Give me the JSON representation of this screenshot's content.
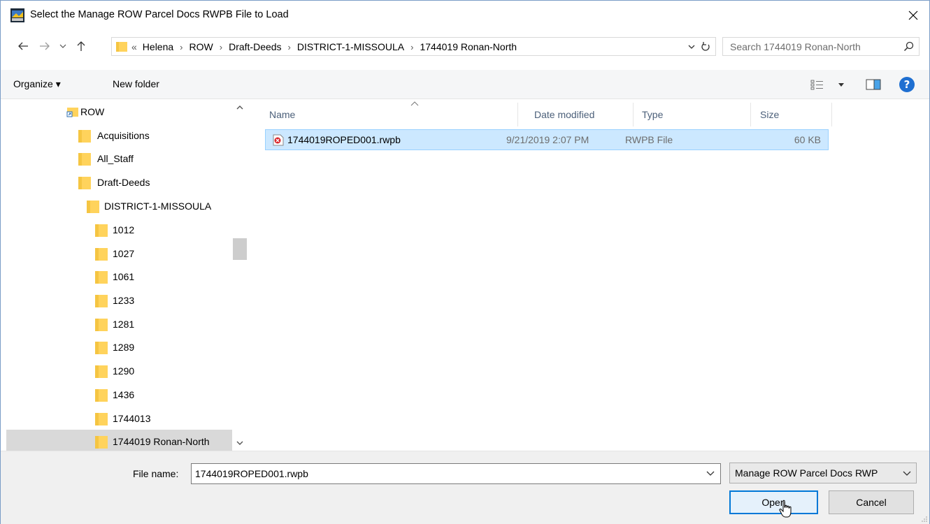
{
  "window": {
    "title": "Select the Manage ROW Parcel Docs RWPB File to Load",
    "close_glyph": "✕"
  },
  "address": {
    "overflow": "«",
    "crumbs": [
      "Helena",
      "ROW",
      "Draft-Deeds",
      "DISTRICT-1-MISSOULA",
      "1744019 Ronan-North"
    ],
    "separator": "›"
  },
  "search": {
    "placeholder": "Search 1744019 Ronan-North"
  },
  "toolbar": {
    "organize_label": "Organize ▾",
    "new_folder_label": "New folder",
    "help_label": "?"
  },
  "nav": {
    "items": [
      {
        "label": "ROW",
        "icon": "shortcut-folder-icon"
      },
      {
        "label": "Acquisitions",
        "icon": "folder-icon"
      },
      {
        "label": "All_Staff",
        "icon": "folder-icon"
      },
      {
        "label": "Draft-Deeds",
        "icon": "folder-icon"
      },
      {
        "label": "DISTRICT-1-MISSOULA",
        "icon": "folder-icon"
      },
      {
        "label": "1012",
        "icon": "folder-icon"
      },
      {
        "label": "1027",
        "icon": "folder-icon"
      },
      {
        "label": "1061",
        "icon": "folder-icon"
      },
      {
        "label": "1233",
        "icon": "folder-icon"
      },
      {
        "label": "1281",
        "icon": "folder-icon"
      },
      {
        "label": "1289",
        "icon": "folder-icon"
      },
      {
        "label": "1290",
        "icon": "folder-icon"
      },
      {
        "label": "1436",
        "icon": "folder-icon"
      },
      {
        "label": "1744013",
        "icon": "folder-icon"
      },
      {
        "label": "1744019 Ronan-North",
        "icon": "folder-icon",
        "selected": true
      }
    ]
  },
  "files": {
    "columns": [
      "Name",
      "Date modified",
      "Type",
      "Size"
    ],
    "rows": [
      {
        "name": "1744019ROPED001.rwpb",
        "date": "9/21/2019 2:07 PM",
        "type": "RWPB File",
        "size": "60 KB"
      }
    ]
  },
  "footer": {
    "file_name_label": "File name:",
    "file_name_value": "1744019ROPED001.rwpb",
    "file_type_value": "Manage ROW Parcel Docs RWP",
    "open_label": "Open",
    "cancel_label": "Cancel"
  },
  "colors": {
    "accent": "#0078d7",
    "selection": "#cce8ff",
    "folder": "#ffd35c"
  }
}
